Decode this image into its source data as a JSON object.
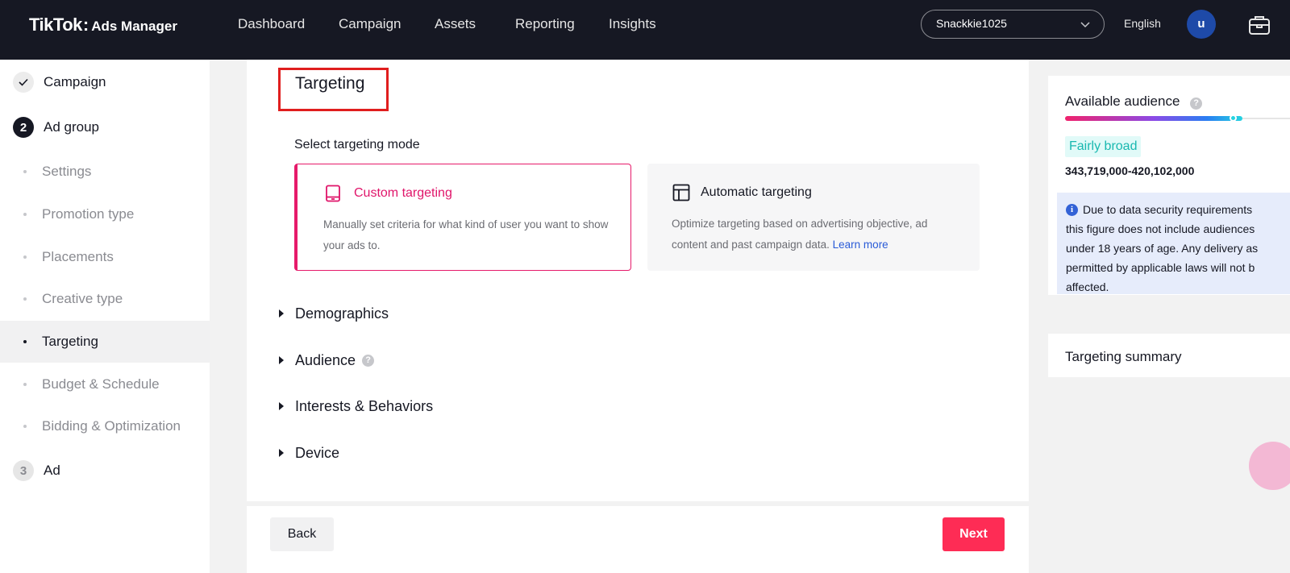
{
  "header": {
    "logo_brand": "TikTok",
    "logo_colon": ":",
    "logo_sub": "Ads Manager",
    "nav": [
      "Dashboard",
      "Campaign",
      "Assets",
      "Reporting",
      "Insights"
    ],
    "account": "Snackkie1025",
    "language": "English",
    "avatar_initial": "u"
  },
  "sidebar": {
    "steps": [
      {
        "number": "",
        "label": "Campaign",
        "state": "done"
      },
      {
        "number": "2",
        "label": "Ad group",
        "state": "active"
      },
      {
        "number": "3",
        "label": "Ad",
        "state": "todo"
      }
    ],
    "substeps": [
      "Settings",
      "Promotion type",
      "Placements",
      "Creative type",
      "Targeting",
      "Budget & Schedule",
      "Bidding & Optimization"
    ],
    "active_substep": "Targeting"
  },
  "main": {
    "section_title": "Targeting",
    "mode_label": "Select targeting mode",
    "custom": {
      "title": "Custom targeting",
      "description": "Manually set criteria for what kind of user you want to show your ads to."
    },
    "automatic": {
      "title": "Automatic targeting",
      "description": "Optimize targeting based on advertising objective, ad content and past campaign data.",
      "link": "Learn more"
    },
    "sections": [
      "Demographics",
      "Audience",
      "Interests & Behaviors",
      "Device"
    ]
  },
  "actions": {
    "back": "Back",
    "next": "Next"
  },
  "right_panel": {
    "available_audience_title": "Available audience",
    "audience_breadth": "Fairly broad",
    "audience_range": "343,719,000-420,102,000",
    "note_lines": [
      "Due to data security requirements",
      "this figure does not include audiences",
      "under 18 years of age. Any delivery as",
      "permitted by applicable laws will not b",
      "affected."
    ],
    "targeting_summary_title": "Targeting summary"
  },
  "colors": {
    "topbar": "#161823",
    "accent": "#fe2c55",
    "custom_accent": "#e0156a",
    "highlight_box": "#e01e1e",
    "badge_text": "#19b8b0",
    "link": "#2a5bd7"
  },
  "icons": {
    "check": "check-icon",
    "account_dropdown": "chevron-down-icon",
    "briefcase": "briefcase-icon",
    "custom_mode": "tablet-icon",
    "automatic_mode": "layout-icon",
    "help": "question-icon",
    "info": "info-icon"
  }
}
